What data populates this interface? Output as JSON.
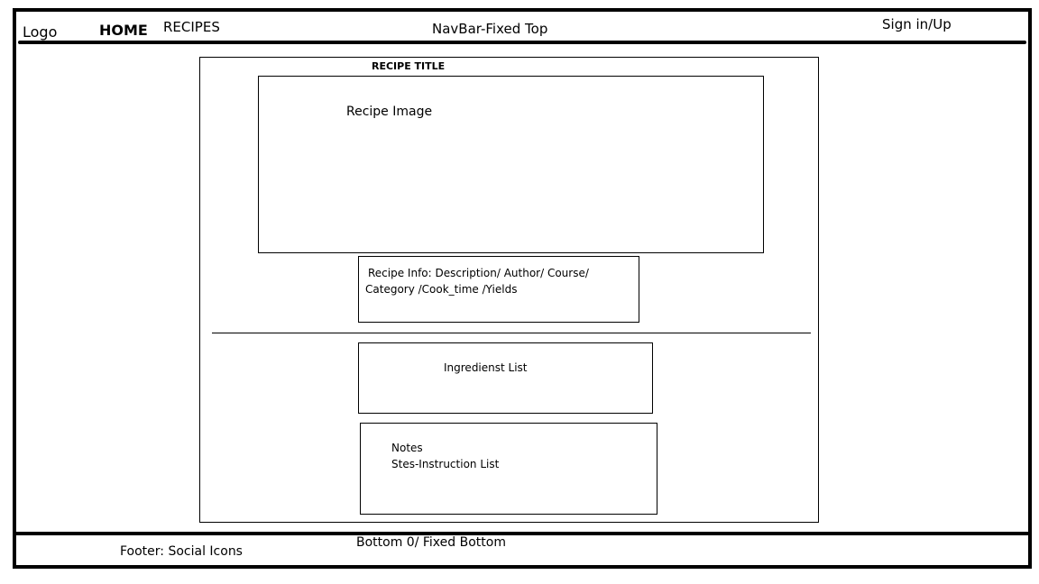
{
  "navbar": {
    "logo": "Logo",
    "home": "HOME",
    "recipes": "RECIPES",
    "caption": "NavBar-Fixed Top",
    "sign_in": "Sign in/Up"
  },
  "main": {
    "recipe_title": "RECIPE TITLE",
    "recipe_image": "Recipe Image",
    "recipe_info_line1": "Recipe Info: Description/ Author/ Course/",
    "recipe_info_line2": "Category /Cook_time /Yields",
    "ingredients": "Ingredienst List",
    "notes": "Notes",
    "steps": "Stes-Instruction List"
  },
  "footer": {
    "social": "Footer: Social Icons",
    "caption": "Bottom 0/ Fixed Bottom"
  }
}
